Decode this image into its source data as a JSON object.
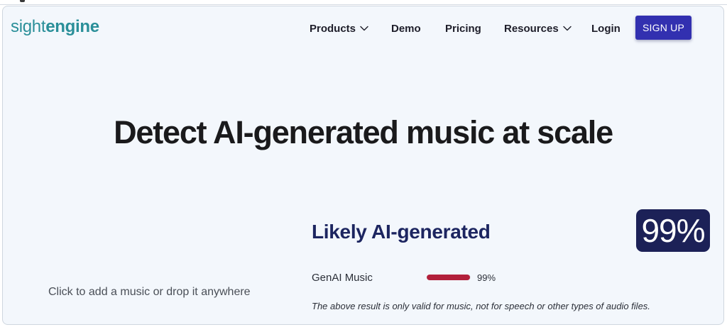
{
  "logo": {
    "part1": "sight",
    "part2": "engine"
  },
  "nav": {
    "items": [
      {
        "label": "Products",
        "icon": "chevron-down-icon"
      },
      {
        "label": "Demo"
      },
      {
        "label": "Pricing"
      },
      {
        "label": "Resources",
        "icon": "chevron-down-icon"
      },
      {
        "label": "Login"
      }
    ],
    "signup_label": "SIGN UP"
  },
  "hero": {
    "title": "Detect AI-generated music at scale"
  },
  "upload": {
    "hint": "Click to add a music or drop it anywhere"
  },
  "result": {
    "verdict": "Likely AI-generated",
    "score_text": "99%",
    "metrics": [
      {
        "label": "GenAI Music",
        "value": 0.99,
        "value_text": "99%"
      }
    ],
    "disclaimer": "The above result is only valid for music, not for speech or other types of audio files."
  },
  "colors": {
    "brand_teal": "#2a8f99",
    "signup_bg": "#3230b0",
    "badge_bg": "#1c2157",
    "verdict_text": "#1c2560",
    "metric_fill": "#b2203b",
    "page_bg": "#f3f7fc"
  }
}
